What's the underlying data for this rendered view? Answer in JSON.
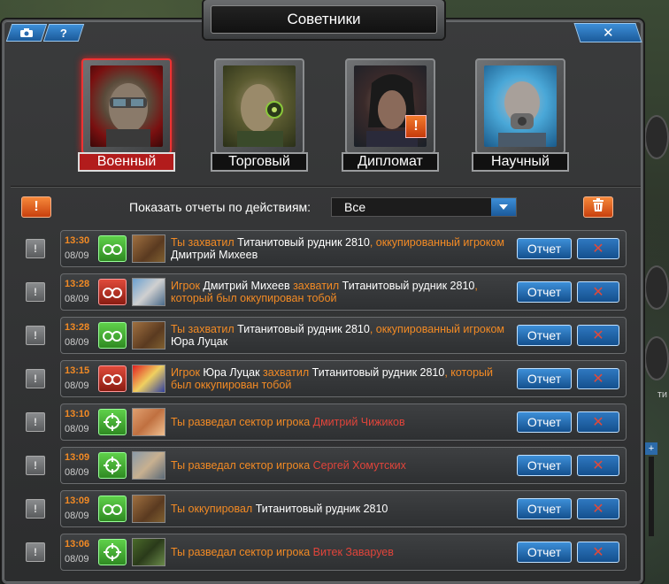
{
  "window": {
    "title": "Советники"
  },
  "toolbar": {
    "camera_icon": "camera-icon",
    "help_label": "?",
    "close_label": "✕"
  },
  "advisors": [
    {
      "label": "Военный",
      "active": true
    },
    {
      "label": "Торговый",
      "active": false
    },
    {
      "label": "Дипломат",
      "active": false,
      "alert": "!"
    },
    {
      "label": "Научный",
      "active": false
    }
  ],
  "filter": {
    "warning_label": "!",
    "label": "Показать отчеты по действиям:",
    "selected": "Все"
  },
  "reports": [
    {
      "time": "13:30",
      "date": "08/09",
      "type": "green-handcuffs",
      "parts": [
        {
          "t": "Ты захватил ",
          "c": "o"
        },
        {
          "t": "Титанитовый рудник 2810",
          "c": "w"
        },
        {
          "t": ", оккупированный игроком ",
          "c": "o"
        },
        {
          "t": "Дмитрий Михеев",
          "c": "w"
        }
      ],
      "button": "Отчет"
    },
    {
      "time": "13:28",
      "date": "08/09",
      "type": "red-handcuffs",
      "parts": [
        {
          "t": "Игрок ",
          "c": "o"
        },
        {
          "t": "Дмитрий Михеев ",
          "c": "w"
        },
        {
          "t": "захватил ",
          "c": "o"
        },
        {
          "t": "Титанитовый рудник 2810",
          "c": "w"
        },
        {
          "t": ", который был оккупирован тобой",
          "c": "o"
        }
      ],
      "button": "Отчет"
    },
    {
      "time": "13:28",
      "date": "08/09",
      "type": "green-handcuffs",
      "parts": [
        {
          "t": "Ты захватил ",
          "c": "o"
        },
        {
          "t": "Титанитовый рудник 2810",
          "c": "w"
        },
        {
          "t": ", оккупированный игроком ",
          "c": "o"
        },
        {
          "t": "Юра Луцак",
          "c": "w"
        }
      ],
      "button": "Отчет"
    },
    {
      "time": "13:15",
      "date": "08/09",
      "type": "red-handcuffs",
      "parts": [
        {
          "t": "Игрок ",
          "c": "o"
        },
        {
          "t": "Юра Луцак ",
          "c": "w"
        },
        {
          "t": "захватил ",
          "c": "o"
        },
        {
          "t": "Титанитовый рудник 2810",
          "c": "w"
        },
        {
          "t": ", который был оккупирован тобой",
          "c": "o"
        }
      ],
      "button": "Отчет"
    },
    {
      "time": "13:10",
      "date": "08/09",
      "type": "green-scout",
      "parts": [
        {
          "t": "Ты разведал сектор игрока ",
          "c": "o"
        },
        {
          "t": "Дмитрий Чижиков",
          "c": "r"
        }
      ],
      "button": "Отчет"
    },
    {
      "time": "13:09",
      "date": "08/09",
      "type": "green-scout",
      "parts": [
        {
          "t": "Ты разведал сектор игрока ",
          "c": "o"
        },
        {
          "t": "Сергей Хомутских",
          "c": "r"
        }
      ],
      "button": "Отчет"
    },
    {
      "time": "13:09",
      "date": "08/09",
      "type": "green-handcuffs",
      "parts": [
        {
          "t": "Ты оккупировал ",
          "c": "o"
        },
        {
          "t": "Титанитовый рудник 2810",
          "c": "w"
        }
      ],
      "button": "Отчет"
    },
    {
      "time": "13:06",
      "date": "08/09",
      "type": "green-scout",
      "parts": [
        {
          "t": "Ты разведал сектор игрока ",
          "c": "o"
        },
        {
          "t": "Витек Заваруев",
          "c": "r"
        }
      ],
      "button": "Отчет"
    }
  ],
  "side": {
    "fragment_text": "ти",
    "scroll_plus": "+"
  },
  "colors": {
    "accent_orange": "#f28a24",
    "accent_red": "#e0443a",
    "button_blue": "#2f78c0"
  }
}
